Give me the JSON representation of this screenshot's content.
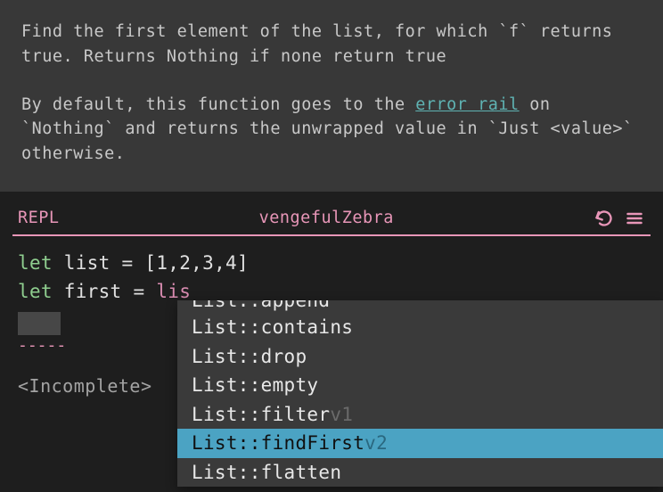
{
  "doc": {
    "line1_a": "Find the first element of the list, for which ",
    "line1_b": "`f`",
    "line2": " returns true. Returns Nothing if none return true",
    "para2_a": "By default, this function goes to the ",
    "para2_link": "error rail",
    "para2_b": " on ",
    "para2_c": "`Nothing`",
    "para2_d": " and returns the unwrapped value in ",
    "para2_e": "`Just <value>`",
    "para2_f": " otherwise."
  },
  "repl": {
    "label": "REPL",
    "title": "vengefulZebra"
  },
  "code": {
    "let1": "let",
    "var1": " list ",
    "eq": "= ",
    "list_literal": "[1,2,3,4]",
    "let2": "let",
    "var2": " first ",
    "typed_partial": "lis",
    "dashes": "-----",
    "status": "<Incomplete>"
  },
  "autocomplete": {
    "truncated_top": "List::append",
    "items": [
      {
        "label": "List::contains",
        "version": "",
        "selected": false
      },
      {
        "label": "List::drop",
        "version": "",
        "selected": false
      },
      {
        "label": "List::empty",
        "version": "",
        "selected": false
      },
      {
        "label": "List::filter",
        "version": "v1",
        "selected": false
      },
      {
        "label": "List::findFirst",
        "version": "v2",
        "selected": true
      },
      {
        "label": "List::flatten",
        "version": "",
        "selected": false
      }
    ]
  }
}
